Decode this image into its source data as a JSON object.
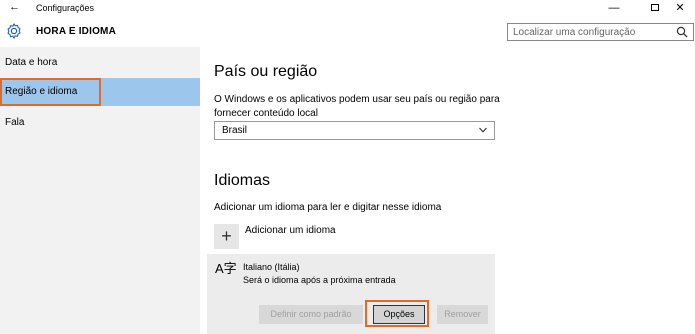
{
  "window": {
    "title": "Configurações",
    "back_icon": "back-arrow-icon",
    "minimize_label": "—",
    "close_label": "✕"
  },
  "header": {
    "app_title": "HORA E IDIOMA",
    "app_icon": "gear-icon",
    "search_placeholder": "Localizar uma configuração"
  },
  "sidebar": {
    "items": [
      {
        "label": "Data e hora",
        "selected": false
      },
      {
        "label": "Região e idioma",
        "selected": true
      },
      {
        "label": "Fala",
        "selected": false
      }
    ],
    "selected_color": "#9dc6ec",
    "highlight_color": "#e06a2a"
  },
  "region": {
    "heading": "País ou região",
    "description": "O Windows e os aplicativos podem usar seu país ou região para fornecer conteúdo local",
    "selected_country": "Brasil"
  },
  "languages": {
    "heading": "Idiomas",
    "add_description": "Adicionar um idioma para ler e digitar nesse idioma",
    "add_button_glyph": "+",
    "add_label": "Adicionar um idioma",
    "item": {
      "name": "Italiano (Itália)",
      "status": "Será o idioma após a próxima entrada",
      "icon": "language-icon",
      "icon_glyph": "A字"
    },
    "buttons": {
      "set_default": "Definir como padrão",
      "options": "Opções",
      "remove": "Remover"
    }
  }
}
